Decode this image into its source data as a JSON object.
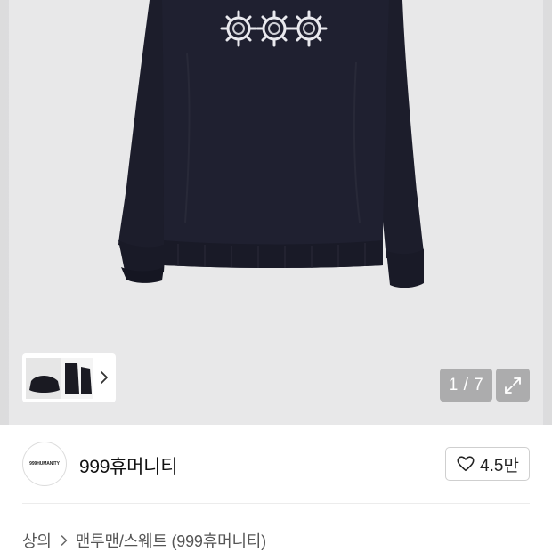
{
  "gallery": {
    "counter": "1 / 7",
    "current_image": 1,
    "total_images": 7,
    "expand_icon": "expand-arrows-icon",
    "thumbnail_more_icon": "chevron-right-icon",
    "background_color": "#e9e9ea"
  },
  "product": {
    "garment_color": "#1c1d2b",
    "print_motif_text": "999"
  },
  "brand": {
    "logo_text": "999HUMANITY",
    "name": "999휴머니티",
    "likes": "4.5만",
    "like_icon": "heart-icon"
  },
  "breadcrumb": {
    "items": [
      "상의",
      "맨투맨/스웨트 (999휴머니티)"
    ],
    "separator_icon": "chevron-right-icon"
  }
}
